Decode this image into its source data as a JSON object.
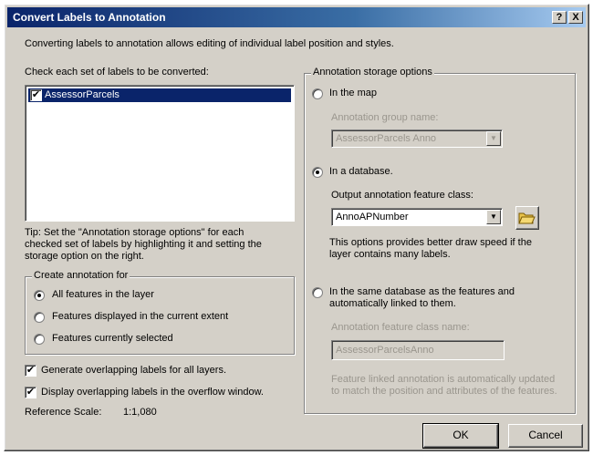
{
  "window": {
    "title": "Convert Labels to Annotation",
    "help_label": "?",
    "close_label": "X"
  },
  "intro": "Converting labels to annotation allows editing of individual label position and styles.",
  "labels_section": {
    "heading": "Check each set of labels to be converted:",
    "items": [
      {
        "label": "AssessorParcels",
        "checked": true
      }
    ],
    "check_mark": "✔"
  },
  "tip": [
    "Tip:  Set the \"Annotation storage options\" for each",
    "checked set of labels by highlighting it and setting the",
    "storage option on the right."
  ],
  "create_for": {
    "legend": "Create annotation for",
    "options": [
      {
        "label": "All features in the layer",
        "selected": true
      },
      {
        "label": "Features displayed in the current extent",
        "selected": false
      },
      {
        "label": "Features currently selected",
        "selected": false
      }
    ]
  },
  "generate_overlap": {
    "label": "Generate overlapping labels for all layers.",
    "checked": true
  },
  "display_overflow": {
    "label": "Display overlapping labels in the overflow window.",
    "checked": true
  },
  "reference_scale": {
    "label": "Reference Scale:",
    "value": "1:1,080"
  },
  "storage": {
    "legend": "Annotation storage options",
    "in_map": {
      "label": "In the map",
      "selected": false,
      "group_name_label": "Annotation group name:",
      "group_name_value": "AssessorParcels Anno"
    },
    "in_database": {
      "label": "In a database.",
      "selected": true,
      "feature_class_label": "Output annotation feature class:",
      "feature_class_value": "AnnoAPNumber",
      "note": [
        "This options provides better draw speed if the",
        "layer contains many labels."
      ]
    },
    "same_database": {
      "label": [
        "In the same database as the features and",
        "automatically linked to them."
      ],
      "selected": false,
      "class_name_label": "Annotation feature class name:",
      "class_name_value": "AssessorParcelsAnno",
      "note": [
        "Feature linked annotation is automatically updated",
        "to match the position and attributes of the features."
      ]
    }
  },
  "buttons": {
    "ok": "OK",
    "cancel": "Cancel"
  },
  "icons": {
    "dropdown": "dropdown-arrow-icon",
    "folder": "open-folder-icon"
  }
}
